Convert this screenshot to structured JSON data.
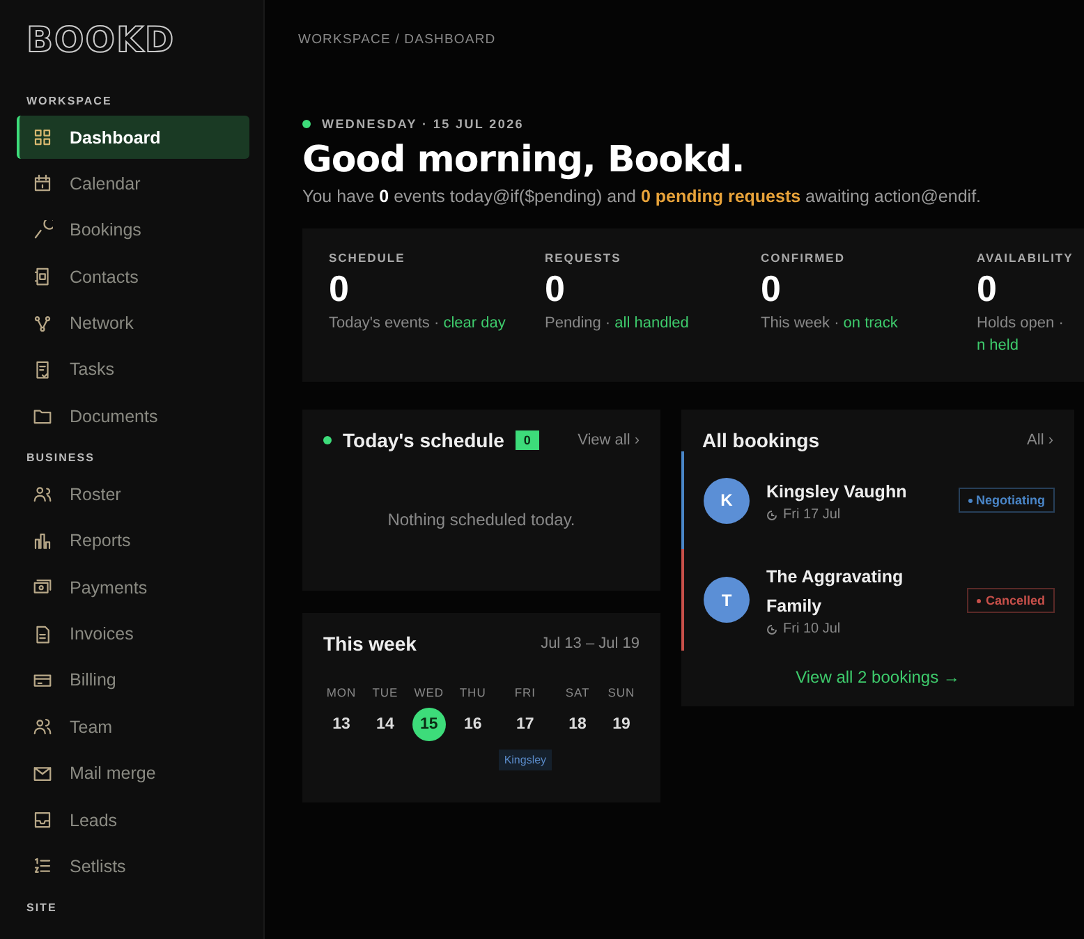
{
  "logo": "BOOKD",
  "sidebar": {
    "sections": [
      {
        "title": "WORKSPACE",
        "items": [
          {
            "label": "Dashboard",
            "selected": true
          },
          {
            "label": "Calendar",
            "selected": false
          },
          {
            "label": "Bookings",
            "selected": false
          },
          {
            "label": "Contacts",
            "selected": false
          },
          {
            "label": "Network",
            "selected": false
          },
          {
            "label": "Tasks",
            "selected": false
          },
          {
            "label": "Documents",
            "selected": false
          }
        ]
      },
      {
        "title": "BUSINESS",
        "items": [
          {
            "label": "Roster",
            "selected": false
          },
          {
            "label": "Reports",
            "selected": false
          },
          {
            "label": "Payments",
            "selected": false
          },
          {
            "label": "Invoices",
            "selected": false
          },
          {
            "label": "Billing",
            "selected": false
          },
          {
            "label": "Team",
            "selected": false
          },
          {
            "label": "Mail merge",
            "selected": false
          },
          {
            "label": "Leads",
            "selected": false
          },
          {
            "label": "Setlists",
            "selected": false
          }
        ]
      },
      {
        "title": "SITE"
      }
    ]
  },
  "breadcrumb": "WORKSPACE / DASHBOARD",
  "date": "WEDNESDAY · 15 JUL 2026",
  "greeting": "Good morning, Bookd.",
  "summary": [
    {
      "text": "You have ",
      "kind": "plain"
    },
    {
      "text": "0",
      "kind": "strong"
    },
    {
      "text": " events today@if($pending) and ",
      "kind": "plain"
    },
    {
      "text": "0 pending requests",
      "kind": "warn"
    },
    {
      "text": " awaiting action@endif.",
      "kind": "plain"
    }
  ],
  "stats": [
    {
      "label": "SCHEDULE",
      "value": "0",
      "hint": "Today's events · ",
      "status": "clear day"
    },
    {
      "label": "REQUESTS",
      "value": "0",
      "hint": "Pending · ",
      "status": "all handled"
    },
    {
      "label": "CONFIRMED",
      "value": "0",
      "hint": "This week · ",
      "status": "on track"
    },
    {
      "label": "AVAILABILITY",
      "value": "0",
      "hint": "Holds open · ",
      "status": "n held"
    }
  ],
  "schedule": {
    "title": "Today's schedule",
    "count": "0",
    "link": "View all ›",
    "empty": "Nothing scheduled today."
  },
  "week": {
    "title": "This week",
    "range": "Jul 13 – Jul 19",
    "days": [
      {
        "name": "MON",
        "date": "13",
        "selected": false
      },
      {
        "name": "TUE",
        "date": "14",
        "selected": false
      },
      {
        "name": "WED",
        "date": "15",
        "selected": true
      },
      {
        "name": "THU",
        "date": "16",
        "selected": false
      },
      {
        "name": "FRI",
        "date": "17",
        "selected": false,
        "event": "Kingsley"
      },
      {
        "name": "SAT",
        "date": "18",
        "selected": false
      },
      {
        "name": "SUN",
        "date": "19",
        "selected": false
      }
    ]
  },
  "bookings": {
    "title": "All bookings",
    "filter": "All ›",
    "items": [
      {
        "initial": "K",
        "name": "Kingsley Vaughn",
        "date": "Fri 17 Jul",
        "status": "Negotiating",
        "color": "#4a86c8"
      },
      {
        "initial": "T",
        "name": "The Aggravating Family",
        "date": "Fri 10 Jul",
        "status": "Cancelled",
        "color": "#c8504a"
      }
    ],
    "footer": "View all 2 bookings →"
  }
}
